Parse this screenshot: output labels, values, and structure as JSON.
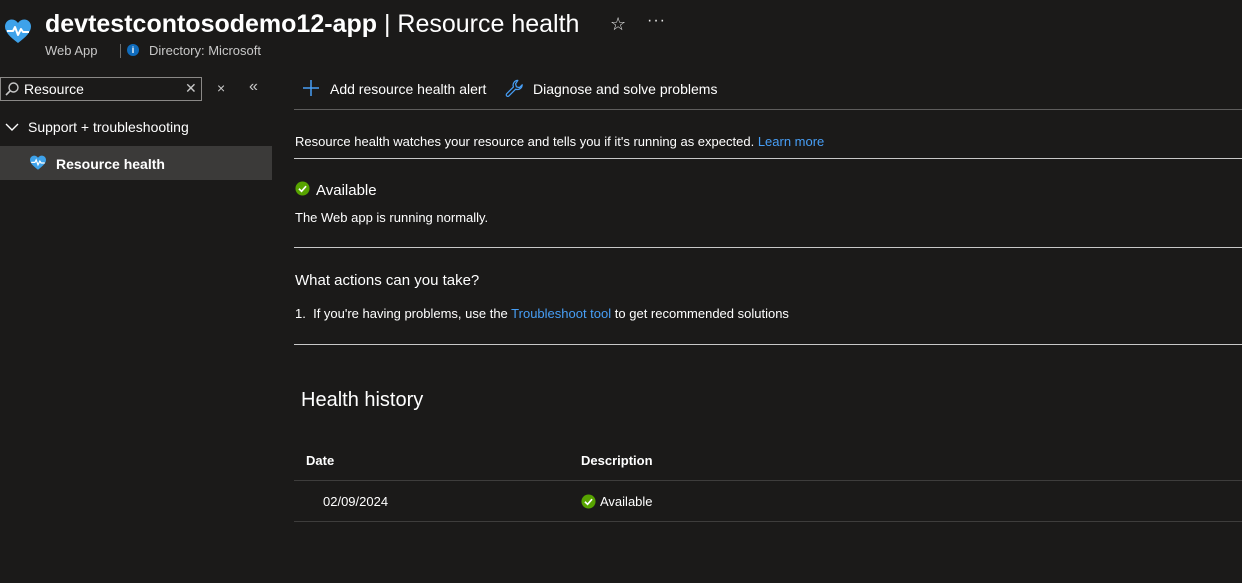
{
  "header": {
    "resource_name": "devtestcontosodemo12-app",
    "separator": " | ",
    "page_title": "Resource health",
    "resource_type": "Web App",
    "directory": "Directory: Microsoft",
    "favorite_icon": "star-icon",
    "more_icon": "ellipsis-icon"
  },
  "sidebar": {
    "search_value": "Resource",
    "search_placeholder": "Search",
    "group_label": "Support + troubleshooting",
    "items": [
      {
        "label": "Resource health",
        "icon": "heart-pulse-icon",
        "selected": true
      }
    ]
  },
  "toolbar": {
    "add_alert_label": "Add resource health alert",
    "diagnose_label": "Diagnose and solve problems"
  },
  "main": {
    "intro_text": "Resource health watches your resource and tells you if it's running as expected.",
    "learn_more": "Learn more",
    "status": {
      "label": "Available",
      "description": "The Web app is running normally."
    },
    "actions_heading": "What actions can you take?",
    "action_1": {
      "number": "1.",
      "before": "If you're having problems, use the",
      "link": "Troubleshoot tool",
      "after": "to get recommended solutions"
    },
    "health_history": {
      "title": "Health history",
      "columns": [
        "Date",
        "Description"
      ],
      "rows": [
        {
          "date": "02/09/2024",
          "description": "Available"
        }
      ]
    }
  },
  "colors": {
    "background": "#1b1a19",
    "link": "#479ef5",
    "available_green": "#57a300",
    "accent_blue": "#3ea2ea",
    "selected_bg": "#3b3a39"
  }
}
